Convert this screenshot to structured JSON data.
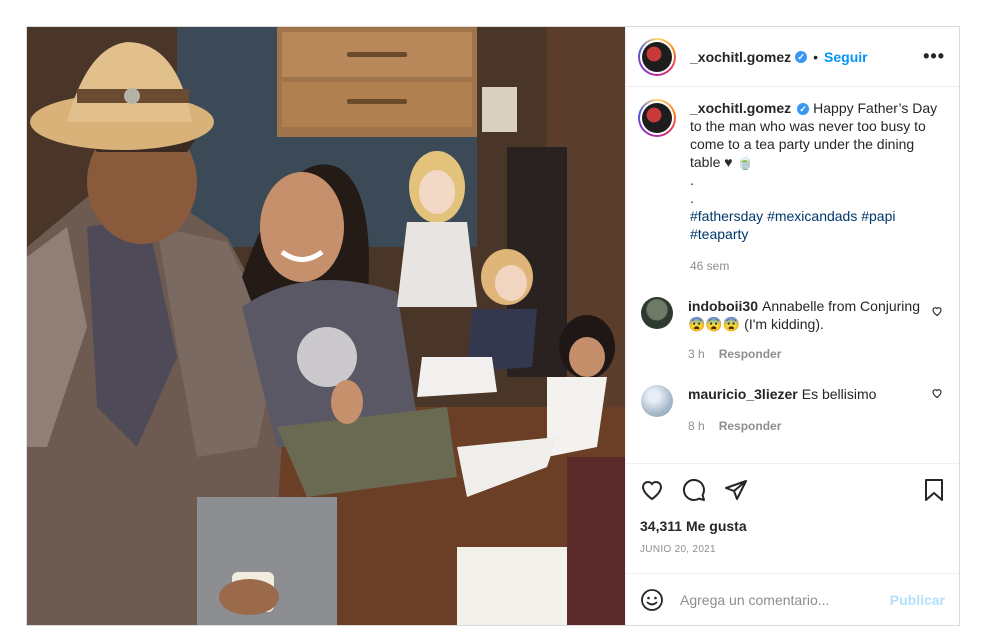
{
  "post": {
    "username": "_xochitl.gomez",
    "follow_label": "Seguir",
    "separator": "•",
    "more_label": "•••",
    "caption": {
      "username": "_xochitl.gomez",
      "text": "Happy Father’s Day to the man who was never too busy to come to a tea party under the dining table ♥ 🍵",
      "dot1": ".",
      "dot2": ".",
      "hashtags": [
        "#fathersday",
        "#mexicandads",
        "#papi",
        "#teaparty"
      ],
      "time": "46 sem"
    },
    "comments": [
      {
        "username": "indoboii30",
        "text": "Annabelle from Conjuring😨😨😨 (I'm kidding).",
        "time": "3 h",
        "reply_label": "Responder"
      },
      {
        "username": "mauricio_3liezer",
        "text": "Es bellisimo",
        "time": "8 h",
        "reply_label": "Responder"
      }
    ],
    "likes": "34,311 Me gusta",
    "date": "JUNIO 20, 2021",
    "add_comment": {
      "placeholder": "Agrega un comentario...",
      "publish_label": "Publicar"
    }
  },
  "colors": {
    "accent": "#0095f6",
    "link": "#00376b",
    "muted": "#8e8e8e",
    "publish_disabled": "#b2dffc",
    "verified": "#3897f0"
  },
  "icons": [
    "verified-badge-icon",
    "more-options-icon",
    "like-icon",
    "comment-icon",
    "share-icon",
    "save-icon",
    "emoji-icon",
    "small-heart-icon"
  ]
}
